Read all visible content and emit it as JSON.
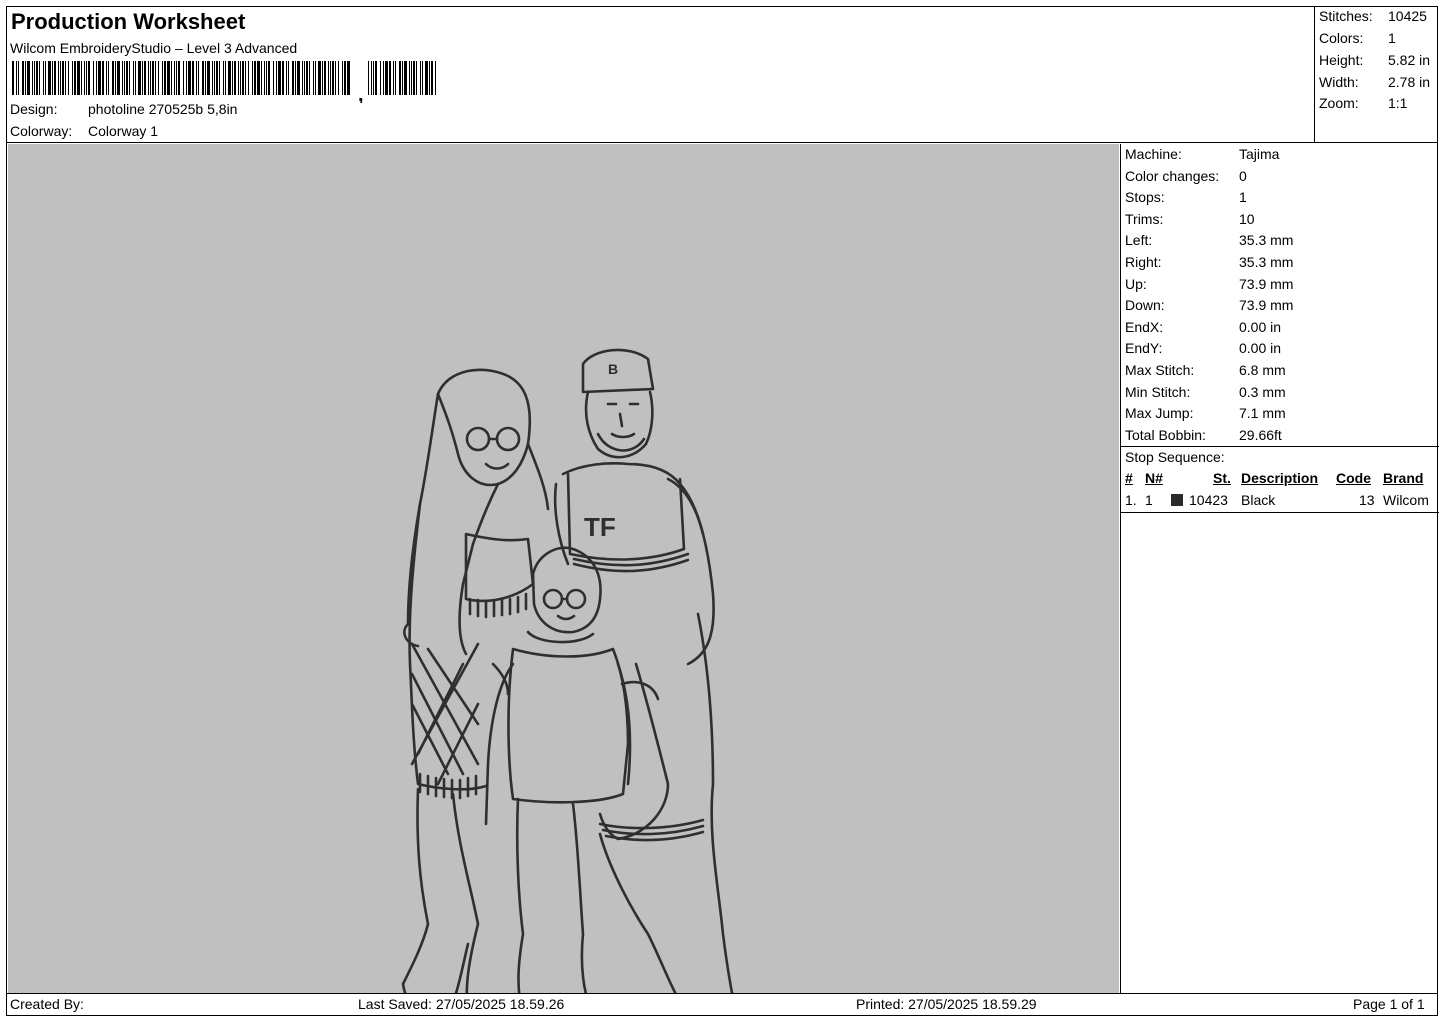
{
  "header": {
    "title": "Production Worksheet",
    "software": "Wilcom EmbroideryStudio – Level 3 Advanced",
    "design_label": "Design:",
    "design_value": "photoline 270525b 5,8in",
    "colorway_label": "Colorway:",
    "colorway_value": "Colorway 1"
  },
  "summary": {
    "stitches_label": "Stitches:",
    "stitches_value": "10425",
    "colors_label": "Colors:",
    "colors_value": "1",
    "height_label": "Height:",
    "height_value": "5.82 in",
    "width_label": "Width:",
    "width_value": "2.78 in",
    "zoom_label": "Zoom:",
    "zoom_value": "1:1"
  },
  "machine": [
    {
      "label": "Machine:",
      "value": "Tajima"
    },
    {
      "label": "Color changes:",
      "value": "0"
    },
    {
      "label": "Stops:",
      "value": "1"
    },
    {
      "label": "Trims:",
      "value": "10"
    },
    {
      "label": "Left:",
      "value": "35.3 mm"
    },
    {
      "label": "Right:",
      "value": "35.3 mm"
    },
    {
      "label": "Up:",
      "value": "73.9 mm"
    },
    {
      "label": "Down:",
      "value": "73.9 mm"
    },
    {
      "label": "EndX:",
      "value": "0.00 in"
    },
    {
      "label": "EndY:",
      "value": "0.00 in"
    },
    {
      "label": "Max Stitch:",
      "value": "6.8 mm"
    },
    {
      "label": "Min Stitch:",
      "value": "0.3 mm"
    },
    {
      "label": "Max Jump:",
      "value": "7.1 mm"
    },
    {
      "label": "Total Bobbin:",
      "value": "29.66ft"
    }
  ],
  "stop_sequence": {
    "title": "Stop Sequence:",
    "headers": {
      "num": "#",
      "n": "N#",
      "st": "St.",
      "desc": "Description",
      "code": "Code",
      "brand": "Brand"
    },
    "rows": [
      {
        "num": "1.",
        "n": "1",
        "color": "#2a2a2a",
        "st": "10423",
        "desc": "Black",
        "code": "13",
        "brand": "Wilcom"
      }
    ]
  },
  "design_preview": {
    "background": "#c0c0c0",
    "thread_color": "#2f2f2f",
    "chest_monogram": "TF",
    "cap_letter": "B"
  },
  "footer": {
    "created_by": "Created By:",
    "last_saved": "Last Saved: 27/05/2025 18.59.26",
    "printed": "Printed: 27/05/2025 18.59.29",
    "page": "Page 1 of 1"
  }
}
